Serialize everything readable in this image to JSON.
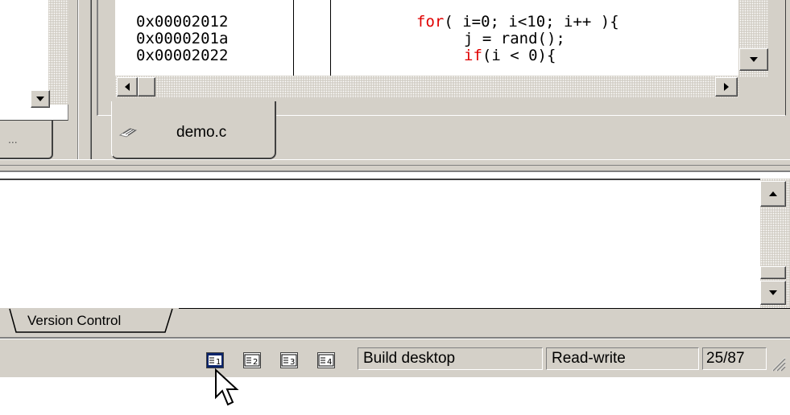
{
  "editor": {
    "addresses": [
      "0x00002012",
      "0x0000201a",
      "0x00002022"
    ],
    "code_lines": [
      "for( i=0; i<10; i++ ){",
      "j = rand();",
      "if(i < 0){"
    ],
    "active_tab": "demo.c"
  },
  "left_panel": {
    "tab_label": "..."
  },
  "output_panel": {
    "tabs": [
      "Version Control"
    ]
  },
  "statusbar": {
    "tile_buttons": [
      "1",
      "2",
      "3",
      "4"
    ],
    "config": "Build desktop",
    "mode": "Read-write",
    "position": "25/87"
  },
  "colors": {
    "face": "#d4d0c8",
    "keyword": "#e00000",
    "tile_selected": "#0a246a"
  },
  "icons": [
    "file-tab-icon",
    "scroll-up-icon",
    "scroll-down-icon",
    "scroll-left-icon",
    "scroll-right-icon",
    "tile-window-icon",
    "arrow-cursor-icon",
    "size-grip-icon"
  ]
}
